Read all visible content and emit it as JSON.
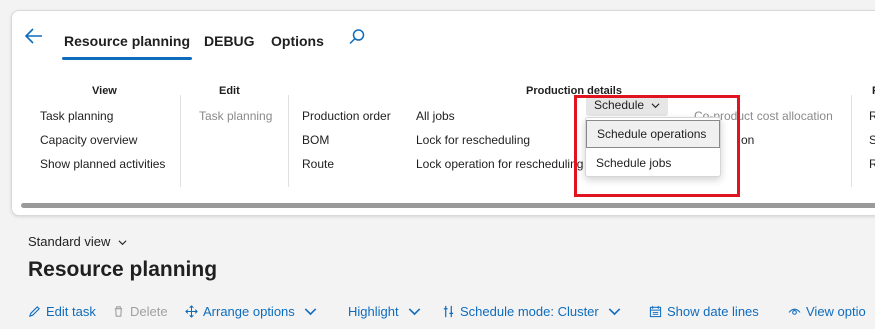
{
  "tabs": [
    {
      "label": "Resource planning"
    },
    {
      "label": "DEBUG"
    },
    {
      "label": "Options"
    }
  ],
  "groups": {
    "view": {
      "title": "View",
      "items": [
        "Task planning",
        "Capacity overview",
        "Show planned activities"
      ]
    },
    "edit": {
      "title": "Edit",
      "items": [
        "Task planning"
      ]
    },
    "production_details": {
      "title": "Production details",
      "col1": [
        "Production order",
        "BOM",
        "Route"
      ],
      "col2": [
        "All jobs",
        "Lock for rescheduling",
        "Lock operation for rescheduling"
      ],
      "schedule_button": "Schedule",
      "co_product": "Co-product cost allocation",
      "partial_hidden": "on"
    },
    "next_group": {
      "title": "P",
      "items": [
        "R",
        "S",
        "R"
      ]
    }
  },
  "dropdown": {
    "items": [
      "Schedule operations",
      "Schedule jobs"
    ]
  },
  "view_selector": "Standard view",
  "page_title": "Resource planning",
  "toolbar": {
    "edit_task": "Edit task",
    "delete": "Delete",
    "arrange_options": "Arrange options",
    "highlight": "Highlight",
    "schedule_mode": "Schedule mode: Cluster",
    "show_date_lines": "Show date lines",
    "view_options": "View optio"
  },
  "colors": {
    "accent": "#0f6cbd",
    "highlight_box": "#e0141e"
  }
}
